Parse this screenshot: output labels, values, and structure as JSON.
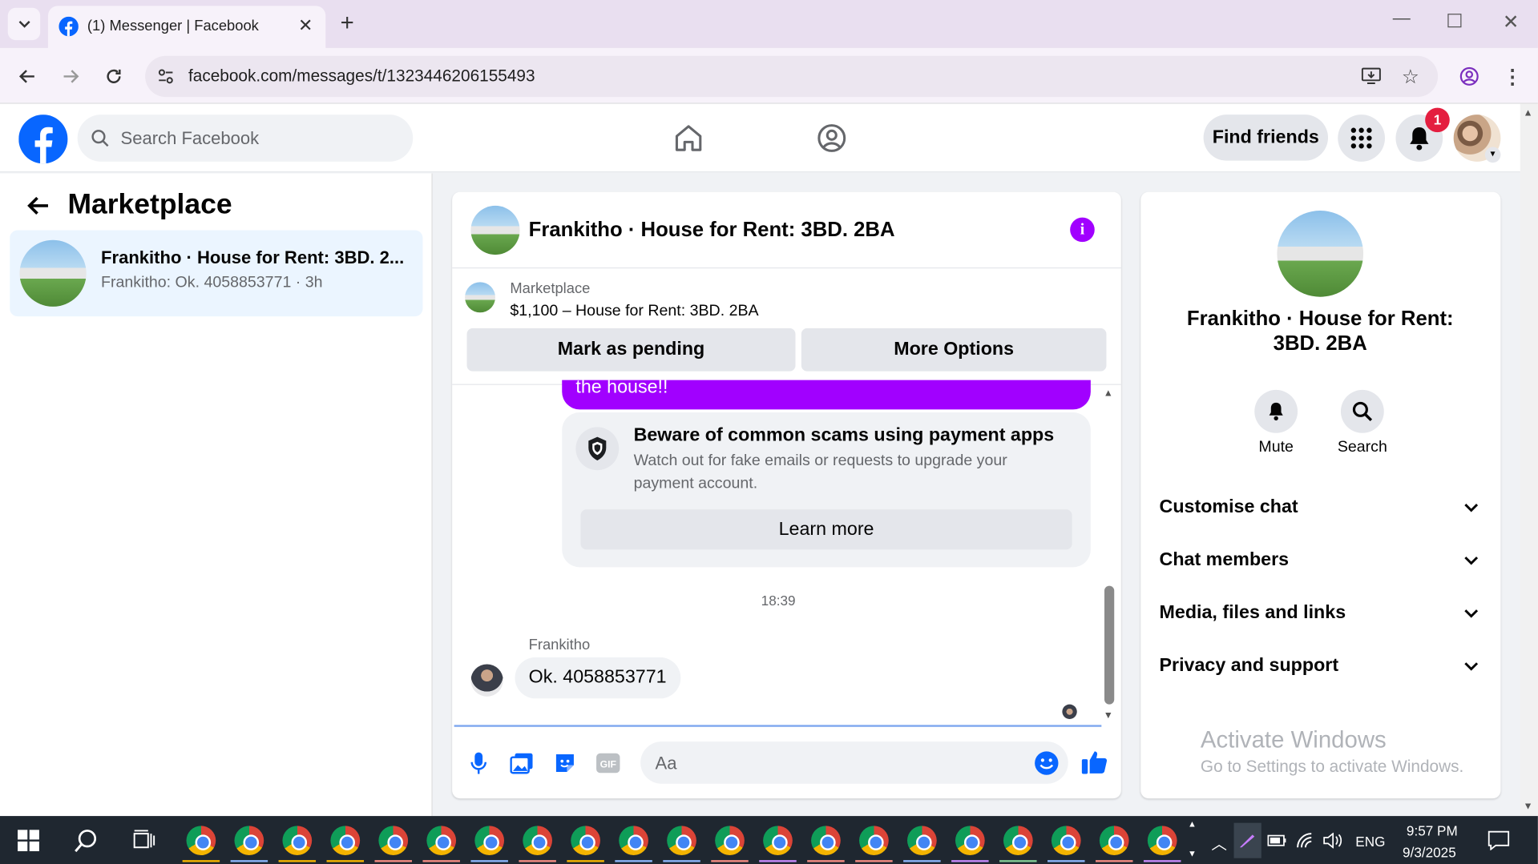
{
  "browser": {
    "tab_title": "(1) Messenger | Facebook",
    "url": "facebook.com/messages/t/1323446206155493"
  },
  "header": {
    "search_placeholder": "Search Facebook",
    "find_friends": "Find friends",
    "notification_count": "1"
  },
  "left_panel": {
    "title": "Marketplace",
    "conversations": [
      {
        "title": "Frankitho · House for Rent: 3BD. 2...",
        "preview": "Frankitho: Ok. 4058853771 · 3h"
      }
    ]
  },
  "chat": {
    "title": "Frankitho · House for Rent: 3BD. 2BA",
    "listing_label": "Marketplace",
    "listing_price": "$1,100 – House for Rent: 3BD. 2BA",
    "mark_pending": "Mark as pending",
    "more_options": "More Options",
    "outgoing_fragment": "the house!!",
    "scam_title": "Beware of common scams using payment apps",
    "scam_desc": "Watch out for fake emails or requests to upgrade your payment account.",
    "learn_more": "Learn more",
    "timestamp": "18:39",
    "sender": "Frankitho",
    "message": "Ok. 4058853771",
    "composer_placeholder": "Aa"
  },
  "right_panel": {
    "name": "Frankitho · House for Rent: 3BD. 2BA",
    "mute": "Mute",
    "search": "Search",
    "sections": [
      "Customise chat",
      "Chat members",
      "Media, files and links",
      "Privacy and support"
    ]
  },
  "watermark": {
    "line1": "Activate Windows",
    "line2": "Go to Settings to activate Windows."
  },
  "taskbar": {
    "lang": "ENG",
    "time": "9:57 PM",
    "date": "9/3/2025"
  },
  "colors": {
    "accent": "#a100ff",
    "fb_blue": "#0866ff",
    "badge": "#e41e3f"
  }
}
